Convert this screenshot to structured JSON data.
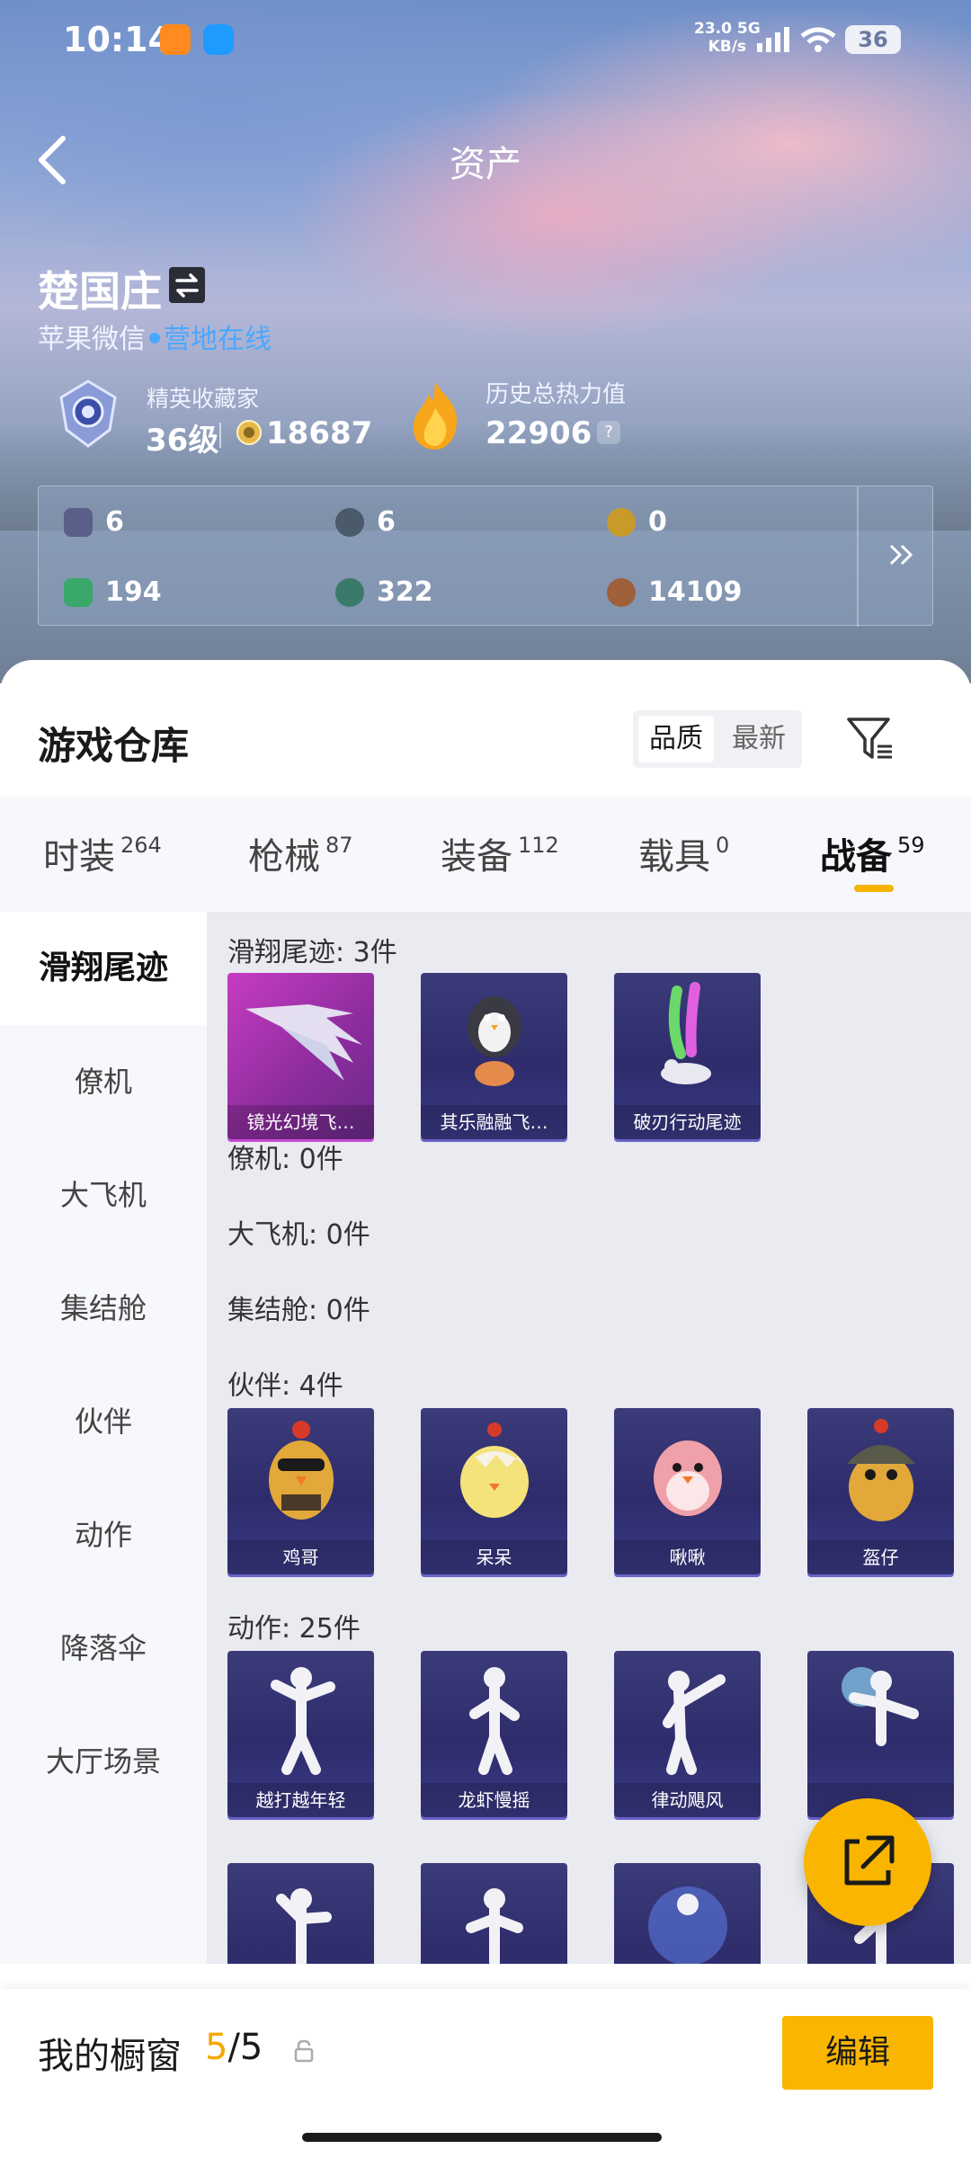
{
  "status_bar": {
    "time": "10:14",
    "net_speed_value": "23.0",
    "net_speed_unit": "KB/s",
    "network": "5G",
    "battery": "36"
  },
  "header": {
    "title": "资产"
  },
  "user": {
    "name": "楚国庄",
    "platform": "苹果微信",
    "online_status": "营地在线"
  },
  "rank": {
    "title": "精英收藏家",
    "level": "36级",
    "points": "18687"
  },
  "heat": {
    "title": "历史总热力值",
    "value": "22906",
    "help_symbol": "?"
  },
  "resources": [
    {
      "icon": "card-icon",
      "value": "6",
      "color": "#5a5f8a"
    },
    {
      "icon": "coupon-icon",
      "value": "6",
      "color": "#4a5a6a"
    },
    {
      "icon": "gold-coupon-icon",
      "value": "0",
      "color": "#c89a2a"
    },
    {
      "icon": "green-ticket-icon",
      "value": "194",
      "color": "#3aa86a"
    },
    {
      "icon": "orb-icon",
      "value": "322",
      "color": "#3a7a6a"
    },
    {
      "icon": "bronze-coin-icon",
      "value": "14109",
      "color": "#a0603a"
    }
  ],
  "warehouse": {
    "title": "游戏仓库",
    "sort_options": [
      "品质",
      "最新"
    ],
    "sort_active": "品质"
  },
  "tabs": [
    {
      "label": "时装",
      "count": "264"
    },
    {
      "label": "枪械",
      "count": "87"
    },
    {
      "label": "装备",
      "count": "112"
    },
    {
      "label": "载具",
      "count": "0"
    },
    {
      "label": "战备",
      "count": "59"
    }
  ],
  "active_tab": "战备",
  "left_nav": [
    "滑翔尾迹",
    "僚机",
    "大飞机",
    "集结舱",
    "伙伴",
    "动作",
    "降落伞",
    "大厅场景"
  ],
  "active_nav": "滑翔尾迹",
  "sections": {
    "glide": {
      "title": "滑翔尾迹: 3件",
      "items": [
        "镜光幻境飞…",
        "其乐融融飞…",
        "破刃行动尾迹"
      ]
    },
    "wingman": {
      "title": "僚机: 0件"
    },
    "plane": {
      "title": "大飞机: 0件"
    },
    "pod": {
      "title": "集结舱: 0件"
    },
    "partner": {
      "title": "伙伴: 4件",
      "items": [
        "鸡哥",
        "呆呆",
        "啾啾",
        "盔仔"
      ]
    },
    "emote": {
      "title": "动作: 25件",
      "items": [
        "越打越年轻",
        "龙虾慢摇",
        "律动飓风",
        ""
      ]
    }
  },
  "showcase": {
    "title": "我的橱窗",
    "current": "5",
    "total": "/5",
    "edit_label": "编辑"
  },
  "colors": {
    "accent": "#f9b500",
    "online": "#4aa8ff"
  }
}
